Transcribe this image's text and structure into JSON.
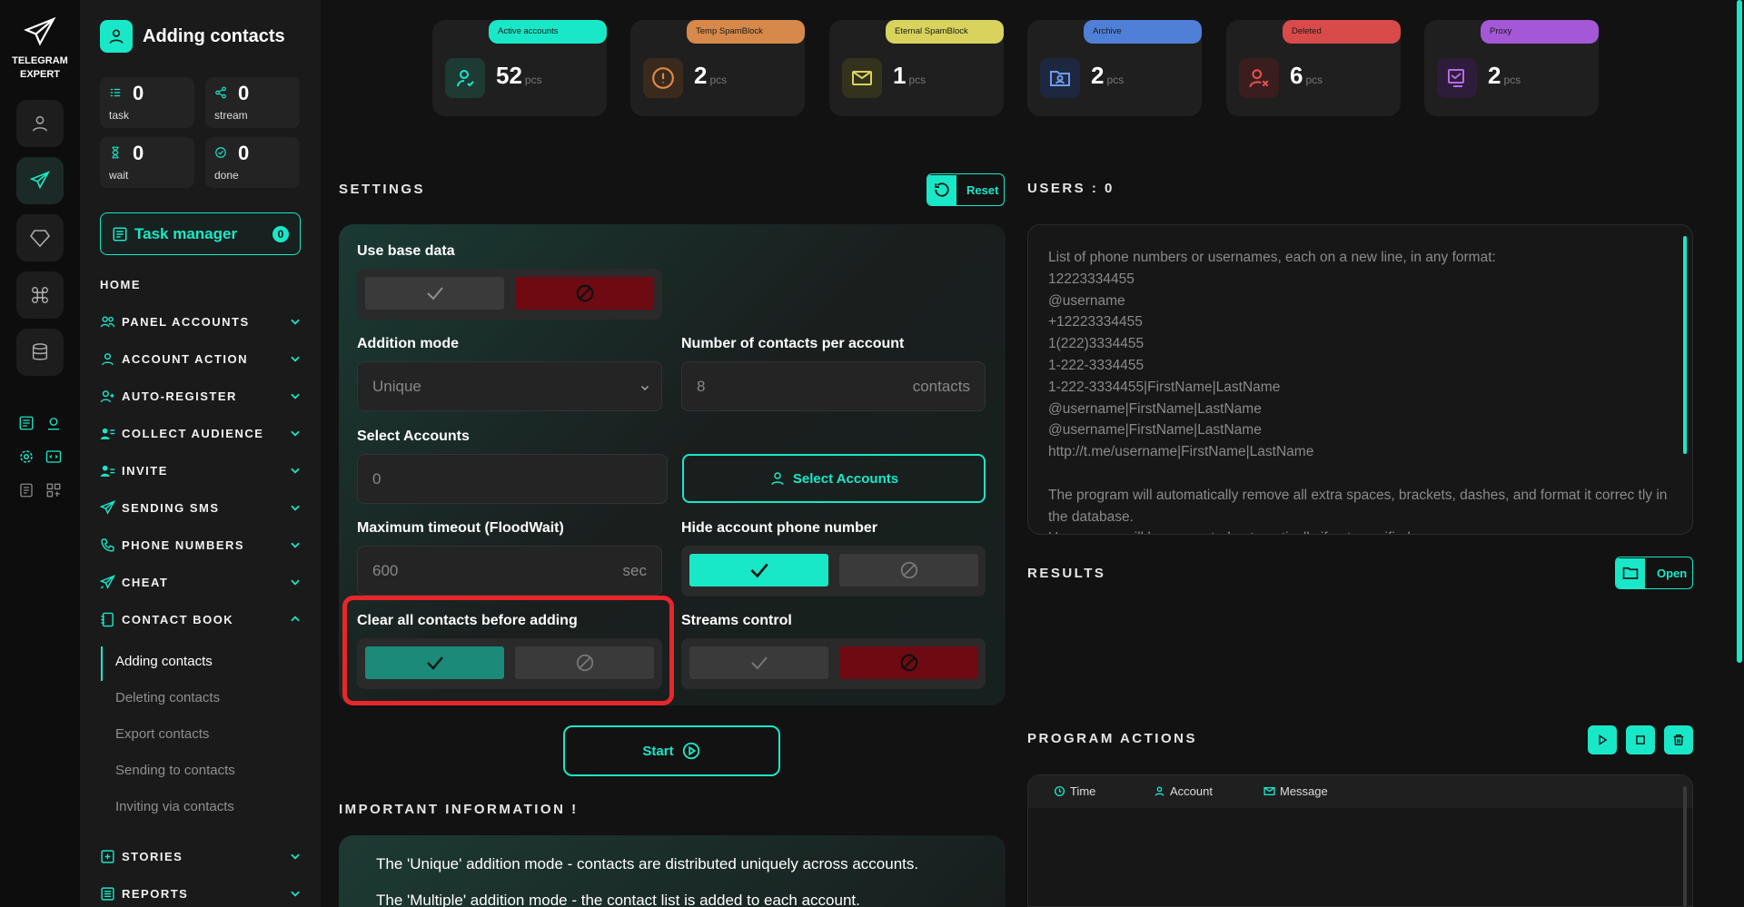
{
  "app": {
    "logo_line1": "TELEGRAM",
    "logo_line2": "EXPERT",
    "accent": "#19e8c8"
  },
  "header": {
    "title": "Adding contacts"
  },
  "stats": {
    "task_value": "0",
    "task_label": "task",
    "stream_value": "0",
    "stream_label": "stream",
    "wait_value": "0",
    "wait_label": "wait",
    "done_value": "0",
    "done_label": "done"
  },
  "task_manager": {
    "label": "Task manager",
    "badge": "0"
  },
  "nav": {
    "home": "HOME",
    "items": [
      "PANEL ACCOUNTS",
      "ACCOUNT ACTION",
      "AUTO-REGISTER",
      "COLLECT AUDIENCE",
      "INVITE",
      "SENDING SMS",
      "PHONE NUMBERS",
      "CHEAT",
      "CONTACT BOOK",
      "STORIES",
      "REPORTS"
    ]
  },
  "contact_book": {
    "items": [
      "Adding contacts",
      "Deleting contacts",
      "Export contacts",
      "Sending to contacts",
      "Inviting via contacts"
    ]
  },
  "cards": [
    {
      "label": "Active accounts",
      "value": "52",
      "unit": "pcs",
      "color": "#19e8c8"
    },
    {
      "label": "Temp SpamBlock",
      "value": "2",
      "unit": "pcs",
      "color": "#d6894a"
    },
    {
      "label": "Eternal SpamBlock",
      "value": "1",
      "unit": "pcs",
      "color": "#d8d35c"
    },
    {
      "label": "Archive",
      "value": "2",
      "unit": "pcs",
      "color": "#4f7fd6"
    },
    {
      "label": "Deleted",
      "value": "6",
      "unit": "pcs",
      "color": "#d94a4a"
    },
    {
      "label": "Proxy",
      "value": "2",
      "unit": "pcs",
      "color": "#a457d6"
    }
  ],
  "settings": {
    "title": "SETTINGS",
    "reset": "Reset",
    "use_base_data": "Use base data",
    "addition_mode": "Addition mode",
    "addition_mode_value": "Unique",
    "contacts_per_account": "Number of contacts per account",
    "contacts_per_account_value": "8",
    "contacts_unit": "contacts",
    "select_accounts": "Select Accounts",
    "select_accounts_value": "0",
    "select_accounts_button": "Select Accounts",
    "max_timeout": "Maximum timeout (FloodWait)",
    "max_timeout_value": "600",
    "sec_unit": "sec",
    "hide_phone": "Hide account phone number",
    "clear_contacts": "Clear all contacts before adding",
    "streams_control": "Streams control",
    "start": "Start"
  },
  "important": {
    "title": "IMPORTANT INFORMATION !",
    "line1": "The 'Unique' addition mode - contacts are distributed uniquely across accounts.",
    "line2": "The 'Multiple' addition mode - the contact list is added to each account."
  },
  "users": {
    "title": "USERS : 0",
    "placeholder": "List of phone numbers or usernames, each on a new line, in any format:\n12223334455\n@username\n+12223334455\n1(222)3334455\n1-222-3334455\n1-222-3334455|FirstName|LastName\n@username|FirstName|LastName\n@username|FirstName|LastName\nhttp://t.me/username|FirstName|LastName\n\nThe program will automatically remove all extra spaces, brackets, dashes, and format it correc tly in the database.\nUsernames will be generated automatically if not specified."
  },
  "results": {
    "title": "RESULTS",
    "open": "Open"
  },
  "program_actions": {
    "title": "PROGRAM ACTIONS",
    "col_time": "Time",
    "col_account": "Account",
    "col_message": "Message"
  }
}
